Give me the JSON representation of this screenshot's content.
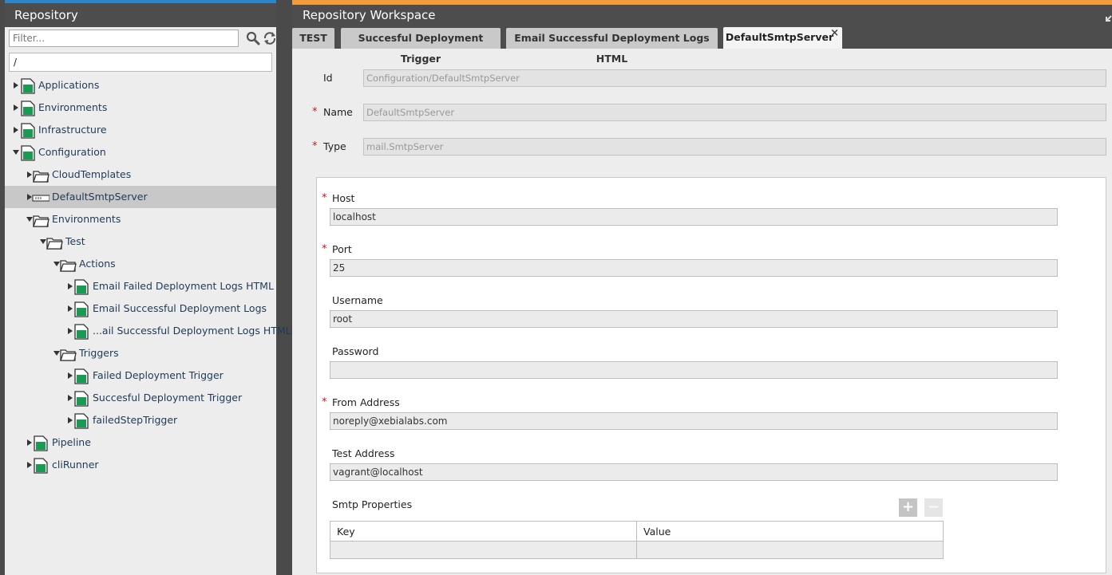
{
  "colors": {
    "repo_accent": "#2c86c8",
    "workspace_accent": "#f39a3d",
    "node_icon": "#1a9a52",
    "required_mark": "#c01a1a"
  },
  "repository": {
    "title": "Repository",
    "filter_placeholder": "Filter...",
    "path_value": "/",
    "tree": [
      {
        "label": "Applications",
        "icon": "ci-icon"
      },
      {
        "label": "Environments",
        "icon": "ci-icon"
      },
      {
        "label": "Infrastructure",
        "icon": "ci-icon"
      },
      {
        "label": "Configuration",
        "icon": "ci-icon"
      },
      {
        "label": "CloudTemplates",
        "icon": "folder-icon"
      },
      {
        "label": "DefaultSmtpServer",
        "icon": "server-icon"
      },
      {
        "label": "Environments",
        "icon": "folder-icon"
      },
      {
        "label": "Test",
        "icon": "folder-icon"
      },
      {
        "label": "Actions",
        "icon": "folder-icon"
      },
      {
        "label": "Email Failed Deployment Logs HTML",
        "icon": "ci-icon"
      },
      {
        "label": "Email Successful Deployment Logs",
        "icon": "ci-icon"
      },
      {
        "label": "...ail Successful Deployment Logs HTML",
        "icon": "ci-icon"
      },
      {
        "label": "Triggers",
        "icon": "folder-icon"
      },
      {
        "label": "Failed Deployment Trigger",
        "icon": "ci-icon"
      },
      {
        "label": "Succesful Deployment Trigger",
        "icon": "ci-icon"
      },
      {
        "label": "failedStepTrigger",
        "icon": "ci-icon"
      },
      {
        "label": "Pipeline",
        "icon": "ci-icon"
      },
      {
        "label": "cliRunner",
        "icon": "ci-icon"
      }
    ]
  },
  "workspace": {
    "title": "Repository Workspace",
    "tabs": [
      {
        "label": "TEST"
      },
      {
        "label": "Succesful Deployment Trigger"
      },
      {
        "label": "Email Successful Deployment Logs HTML"
      },
      {
        "label": "DefaultSmtpServer",
        "close": "×"
      }
    ],
    "fields": {
      "id": {
        "label": "Id",
        "value": "Configuration/DefaultSmtpServer"
      },
      "name": {
        "label": "Name",
        "value": "DefaultSmtpServer"
      },
      "type": {
        "label": "Type",
        "value": "mail.SmtpServer"
      }
    },
    "required_mark": "*",
    "smtp": {
      "host": {
        "label": "Host",
        "value": "localhost"
      },
      "port": {
        "label": "Port",
        "value": "25"
      },
      "username": {
        "label": "Username",
        "value": "root"
      },
      "password": {
        "label": "Password",
        "value": ""
      },
      "from_address": {
        "label": "From Address",
        "value": "noreply@xebialabs.com"
      },
      "test_address": {
        "label": "Test Address",
        "value": "vagrant@localhost"
      },
      "properties": {
        "label": "Smtp Properties",
        "add_label": "+",
        "remove_label": "−",
        "columns": [
          "Key",
          "Value"
        ]
      }
    }
  }
}
